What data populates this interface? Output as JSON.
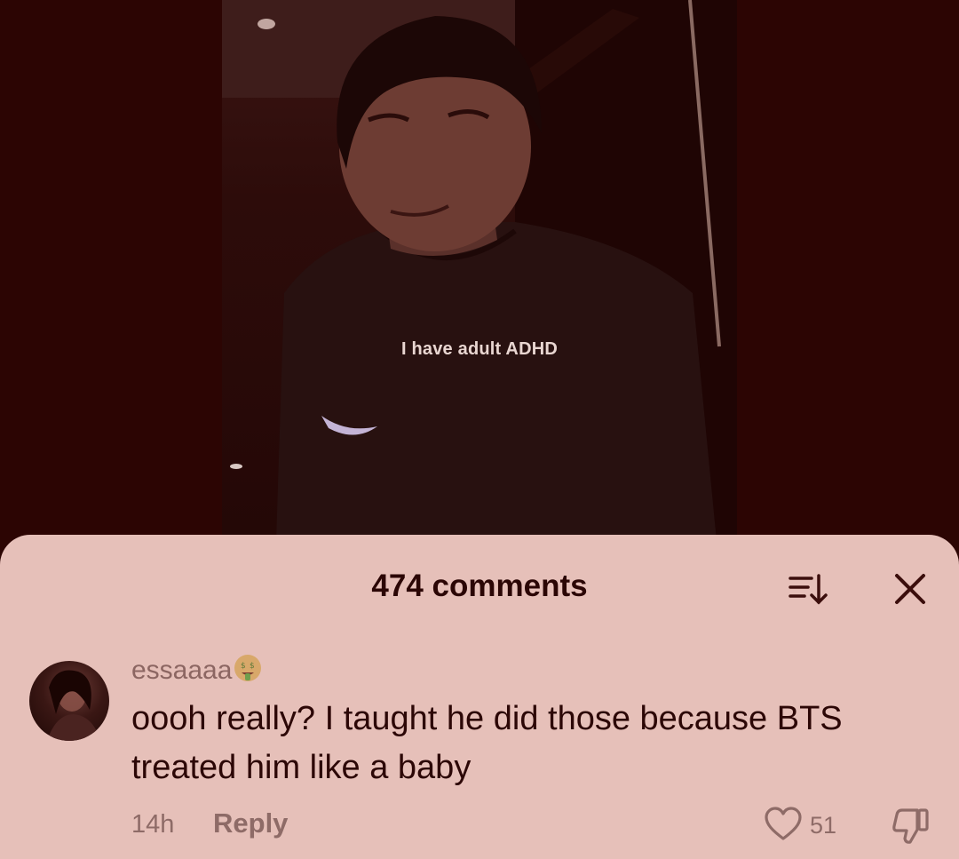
{
  "video": {
    "caption": "I have adult ADHD"
  },
  "comments_sheet": {
    "title": "474 comments",
    "sort_icon": "sort-descending-icon",
    "close_icon": "close-icon"
  },
  "comment": {
    "username": "essaaaa",
    "username_emoji": "money-mouth-face-emoji",
    "text": "oooh really? I taught he did those because BTS treated him like a baby",
    "time": "14h",
    "reply_label": "Reply",
    "like_count": "51",
    "like_icon": "heart-icon",
    "dislike_icon": "thumbs-down-icon"
  },
  "colors": {
    "background": "#2c0503",
    "sheet": "#e6c0b9",
    "text_primary": "#2c0706",
    "text_secondary": "#8e6b67"
  }
}
